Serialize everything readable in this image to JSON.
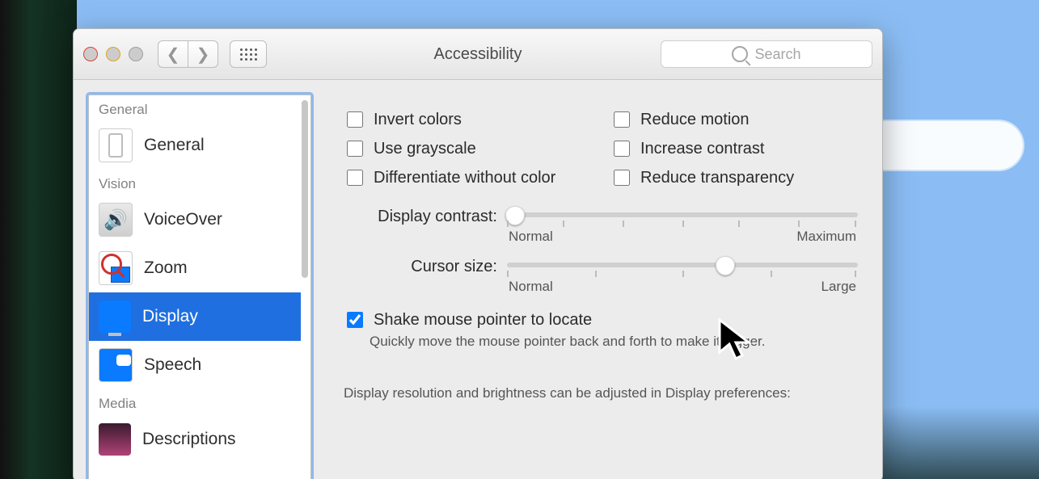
{
  "window": {
    "title": "Accessibility",
    "search_placeholder": "Search"
  },
  "sidebar": {
    "sections": [
      {
        "header": "General",
        "items": [
          {
            "label": "General",
            "icon": "general-icon"
          }
        ]
      },
      {
        "header": "Vision",
        "items": [
          {
            "label": "VoiceOver",
            "icon": "voiceover-icon"
          },
          {
            "label": "Zoom",
            "icon": "zoom-icon"
          },
          {
            "label": "Display",
            "icon": "display-icon",
            "selected": true
          },
          {
            "label": "Speech",
            "icon": "speech-icon"
          }
        ]
      },
      {
        "header": "Media",
        "items": [
          {
            "label": "Descriptions",
            "icon": "descriptions-icon"
          }
        ]
      }
    ]
  },
  "checkboxes": {
    "invert_colors": {
      "label": "Invert colors",
      "checked": false
    },
    "reduce_motion": {
      "label": "Reduce motion",
      "checked": false
    },
    "use_grayscale": {
      "label": "Use grayscale",
      "checked": false
    },
    "increase_contrast": {
      "label": "Increase contrast",
      "checked": false
    },
    "differentiate": {
      "label": "Differentiate without color",
      "checked": false
    },
    "reduce_transparency": {
      "label": "Reduce transparency",
      "checked": false
    }
  },
  "sliders": {
    "contrast": {
      "label": "Display contrast:",
      "left_end": "Normal",
      "right_end": "Maximum",
      "value_pct": 2
    },
    "cursor": {
      "label": "Cursor size:",
      "left_end": "Normal",
      "right_end": "Large",
      "value_pct": 62
    }
  },
  "shake": {
    "label": "Shake mouse pointer to locate",
    "checked": true,
    "description": "Quickly move the mouse pointer back and forth to make it bigger."
  },
  "bottom_note": "Display resolution and brightness can be adjusted in Display preferences:"
}
